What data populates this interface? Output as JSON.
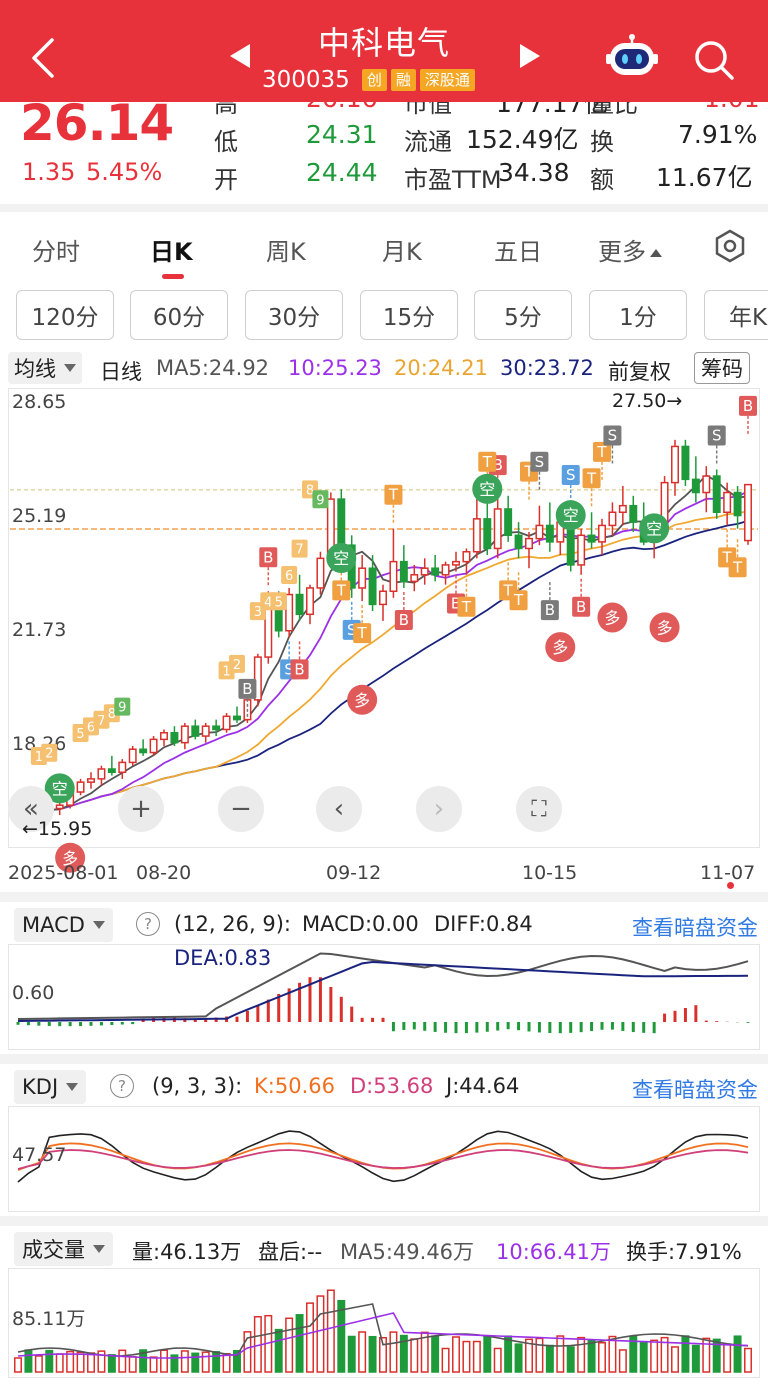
{
  "header": {
    "title": "中科电气",
    "code": "300035",
    "tags": [
      "创",
      "融",
      "深股通"
    ]
  },
  "quote": {
    "price": "26.14",
    "change": "1.35",
    "change_pct": "5.45%",
    "rows": [
      {
        "l1": "高",
        "v1": "26.16",
        "l2": "市值",
        "v2": "177.17亿",
        "l3": "量比",
        "v3": "1.01"
      },
      {
        "l1": "低",
        "v1": "24.31",
        "l2": "流通",
        "v2": "152.49亿",
        "l3": "换",
        "v3": "7.91%"
      },
      {
        "l1": "开",
        "v1": "24.44",
        "l2": "市盈TTM",
        "v2": "34.38",
        "l3": "额",
        "v3": "11.67亿"
      }
    ]
  },
  "period_tabs": [
    "分时",
    "日K",
    "周K",
    "月K",
    "五日",
    "更多"
  ],
  "active_tab": "日K",
  "minute_buttons": [
    "120分",
    "60分",
    "30分",
    "15分",
    "5分",
    "1分",
    "年K"
  ],
  "main_chart": {
    "indicator": "均线",
    "period": "日线",
    "ma5": "MA5:24.92",
    "ma10": "10:25.23",
    "ma20": "20:24.21",
    "ma30": "30:23.72",
    "adjust": "前复权",
    "chip": "筹码",
    "y_ticks": [
      "28.65",
      "25.19",
      "21.73",
      "18.26"
    ],
    "high_label": "27.50→",
    "low_label": "←15.95",
    "x_ticks": [
      "2025-08-01",
      "08-20",
      "09-12",
      "10-15",
      "11-07"
    ],
    "colors": {
      "up": "#d9302b",
      "down": "#1f9a3a",
      "ma5": "#555555",
      "ma10": "#9b30e8",
      "ma20": "#f0a830",
      "ma30": "#1a237e"
    }
  },
  "chart_data": [
    {
      "type": "candlestick",
      "title": "日线",
      "ylim": [
        15.95,
        28.65
      ],
      "x_ticks": [
        "2025-08-01",
        "08-20",
        "09-12",
        "10-15",
        "11-07"
      ],
      "y_ticks": [
        28.65,
        25.19,
        21.73,
        18.26
      ],
      "candles": [
        [
          16.0,
          16.3,
          15.95,
          16.2
        ],
        [
          16.2,
          16.4,
          16.0,
          16.1
        ],
        [
          16.1,
          16.5,
          16.0,
          16.4
        ],
        [
          16.4,
          16.6,
          16.2,
          16.3
        ],
        [
          16.3,
          16.5,
          16.1,
          16.4
        ],
        [
          16.4,
          16.9,
          16.3,
          16.8
        ],
        [
          16.8,
          17.2,
          16.7,
          17.1
        ],
        [
          17.1,
          17.4,
          16.9,
          17.2
        ],
        [
          17.2,
          17.6,
          17.0,
          17.5
        ],
        [
          17.5,
          17.9,
          17.3,
          17.4
        ],
        [
          17.4,
          17.8,
          17.2,
          17.7
        ],
        [
          17.7,
          18.2,
          17.6,
          18.1
        ],
        [
          18.1,
          18.4,
          17.9,
          18.0
        ],
        [
          18.0,
          18.5,
          17.9,
          18.4
        ],
        [
          18.4,
          18.7,
          18.2,
          18.6
        ],
        [
          18.6,
          18.8,
          18.2,
          18.3
        ],
        [
          18.3,
          18.9,
          18.1,
          18.8
        ],
        [
          18.8,
          19.0,
          18.4,
          18.5
        ],
        [
          18.5,
          18.9,
          18.3,
          18.8
        ],
        [
          18.8,
          19.0,
          18.5,
          18.7
        ],
        [
          18.7,
          19.2,
          18.6,
          19.1
        ],
        [
          19.1,
          19.4,
          18.9,
          19.0
        ],
        [
          19.0,
          19.8,
          18.9,
          19.6
        ],
        [
          19.6,
          21.0,
          19.4,
          20.9
        ],
        [
          20.9,
          22.9,
          20.7,
          22.6
        ],
        [
          22.6,
          22.9,
          21.5,
          21.7
        ],
        [
          21.7,
          23.0,
          21.5,
          22.8
        ],
        [
          22.8,
          23.4,
          22.0,
          22.2
        ],
        [
          22.2,
          23.1,
          21.9,
          23.0
        ],
        [
          23.0,
          24.1,
          22.8,
          23.9
        ],
        [
          23.9,
          25.9,
          23.7,
          25.7
        ],
        [
          25.7,
          26.0,
          23.9,
          24.3
        ],
        [
          24.3,
          24.6,
          22.7,
          23.0
        ],
        [
          23.0,
          24.0,
          22.6,
          23.6
        ],
        [
          23.6,
          24.0,
          22.3,
          22.5
        ],
        [
          22.5,
          23.1,
          22.0,
          22.9
        ],
        [
          22.9,
          24.8,
          22.7,
          23.8
        ],
        [
          23.8,
          24.3,
          23.0,
          23.2
        ],
        [
          23.2,
          23.7,
          22.9,
          23.4
        ],
        [
          23.4,
          23.9,
          23.1,
          23.6
        ],
        [
          23.6,
          24.0,
          23.2,
          23.4
        ],
        [
          23.4,
          23.8,
          23.1,
          23.7
        ],
        [
          23.7,
          24.1,
          23.5,
          23.8
        ],
        [
          23.8,
          24.2,
          23.4,
          24.1
        ],
        [
          24.1,
          25.7,
          23.9,
          25.1
        ],
        [
          25.1,
          25.8,
          24.0,
          24.2
        ],
        [
          24.2,
          25.7,
          23.9,
          25.4
        ],
        [
          25.4,
          25.8,
          24.4,
          24.6
        ],
        [
          24.6,
          25.0,
          23.9,
          24.2
        ],
        [
          24.2,
          24.7,
          23.6,
          24.5
        ],
        [
          24.5,
          25.5,
          24.3,
          24.9
        ],
        [
          24.9,
          25.6,
          24.1,
          24.4
        ],
        [
          24.4,
          25.2,
          24.0,
          25.0
        ],
        [
          25.0,
          25.4,
          23.5,
          23.7
        ],
        [
          23.7,
          24.8,
          23.4,
          24.6
        ],
        [
          24.6,
          25.3,
          24.2,
          24.4
        ],
        [
          24.4,
          25.1,
          24.0,
          24.9
        ],
        [
          24.9,
          25.6,
          24.6,
          25.3
        ],
        [
          25.3,
          26.1,
          24.9,
          25.5
        ],
        [
          25.5,
          25.8,
          24.7,
          25.0
        ],
        [
          25.0,
          25.6,
          24.3,
          24.4
        ],
        [
          24.4,
          25.0,
          23.9,
          24.8
        ],
        [
          24.8,
          26.4,
          24.6,
          26.2
        ],
        [
          26.2,
          27.5,
          25.8,
          27.3
        ],
        [
          27.3,
          27.5,
          26.1,
          26.3
        ],
        [
          26.3,
          27.0,
          25.6,
          25.9
        ],
        [
          25.9,
          26.7,
          25.3,
          26.4
        ],
        [
          26.4,
          26.6,
          25.1,
          25.3
        ],
        [
          25.3,
          26.2,
          24.9,
          25.9
        ],
        [
          25.9,
          26.1,
          24.8,
          25.2
        ],
        [
          24.44,
          26.16,
          24.31,
          26.14
        ]
      ],
      "ma5": 24.92,
      "ma10": 25.23,
      "ma20": 24.21,
      "ma30": 23.72
    },
    {
      "type": "line",
      "title": "MACD",
      "params": "(12, 26, 9)",
      "macd": 0.0,
      "diff": 0.84,
      "dea": 0.83,
      "y_tick": "0.60"
    },
    {
      "type": "line",
      "title": "KDJ",
      "params": "(9, 3, 3)",
      "k": 50.66,
      "d": 53.68,
      "j": 44.64,
      "y_tick": "47.57"
    },
    {
      "type": "bar",
      "title": "成交量",
      "volume": "量:46.13万",
      "y_tick": "85.11万",
      "ma5": "MA5:49.46万",
      "ma10": "10:66.41万",
      "turnover": "换手:7.91%"
    }
  ],
  "controls": {
    "back_all": "«",
    "zoom_in": "+",
    "zoom_out": "−",
    "prev": "‹",
    "next": "›",
    "fullscreen": "⛶"
  },
  "macd_panel": {
    "name": "MACD",
    "params": "(12, 26, 9):",
    "macd": "MACD:0.00",
    "diff": "DIFF:0.84",
    "dea": "DEA:0.83",
    "y_tick": "0.60",
    "link": "查看暗盘资金"
  },
  "kdj_panel": {
    "name": "KDJ",
    "params": "(9, 3, 3):",
    "k": "K:50.66",
    "d": "D:53.68",
    "j": "J:44.64",
    "y_tick": "47.57",
    "link": "查看暗盘资金"
  },
  "vol_panel": {
    "name": "成交量",
    "volume": "量:46.13万",
    "after": "盘后:--",
    "ma5": "MA5:49.46万",
    "ma10": "10:66.41万",
    "turnover": "换手:7.91%",
    "y_tick": "85.11万"
  },
  "signals": {
    "kong": "空",
    "duo": "多",
    "buy": "B",
    "sell": "S",
    "t": "T",
    "nums": [
      "1",
      "2",
      "3",
      "4",
      "5",
      "6",
      "7",
      "8",
      "9"
    ]
  }
}
